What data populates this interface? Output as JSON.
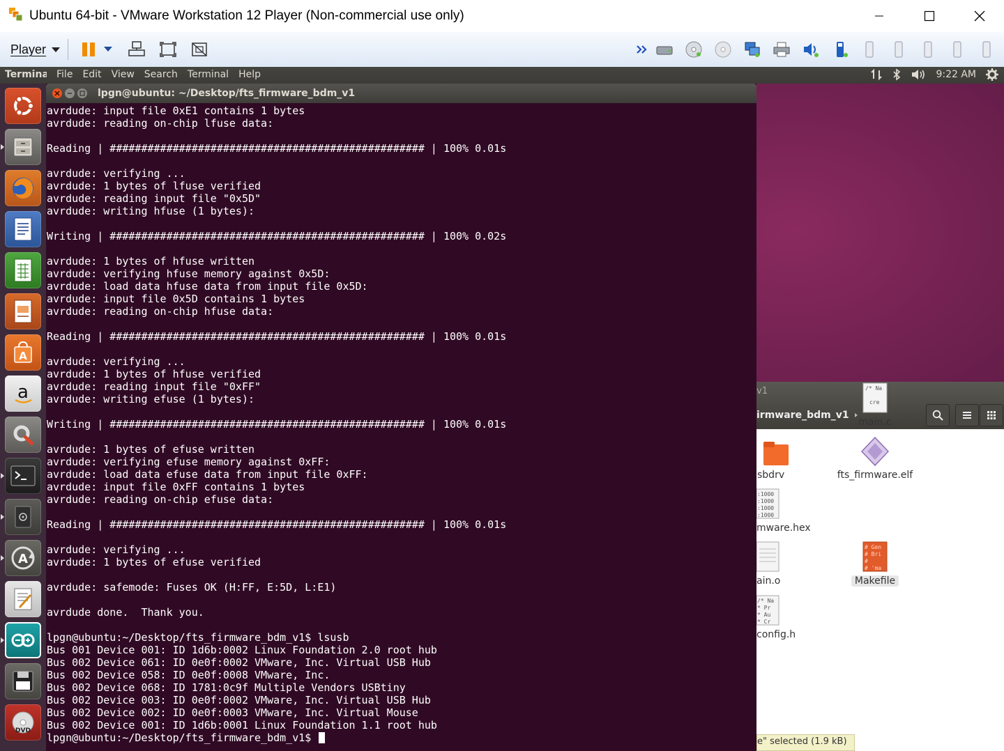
{
  "window": {
    "title": "Ubuntu 64-bit - VMware Workstation 12 Player (Non-commercial use only)"
  },
  "vm_toolbar": {
    "player_label": "Player"
  },
  "ubuntu_panel": {
    "app_name": "Terminal",
    "menus": [
      "File",
      "Edit",
      "View",
      "Search",
      "Terminal",
      "Help"
    ],
    "time": "9:22 AM"
  },
  "terminal": {
    "title": "lpgn@ubuntu: ~/Desktop/fts_firmware_bdm_v1",
    "lines": [
      "avrdude: input file 0xE1 contains 1 bytes",
      "avrdude: reading on-chip lfuse data:",
      "",
      "Reading | ################################################## | 100% 0.01s",
      "",
      "avrdude: verifying ...",
      "avrdude: 1 bytes of lfuse verified",
      "avrdude: reading input file \"0x5D\"",
      "avrdude: writing hfuse (1 bytes):",
      "",
      "Writing | ################################################## | 100% 0.02s",
      "",
      "avrdude: 1 bytes of hfuse written",
      "avrdude: verifying hfuse memory against 0x5D:",
      "avrdude: load data hfuse data from input file 0x5D:",
      "avrdude: input file 0x5D contains 1 bytes",
      "avrdude: reading on-chip hfuse data:",
      "",
      "Reading | ################################################## | 100% 0.01s",
      "",
      "avrdude: verifying ...",
      "avrdude: 1 bytes of hfuse verified",
      "avrdude: reading input file \"0xFF\"",
      "avrdude: writing efuse (1 bytes):",
      "",
      "Writing | ################################################## | 100% 0.01s",
      "",
      "avrdude: 1 bytes of efuse written",
      "avrdude: verifying efuse memory against 0xFF:",
      "avrdude: load data efuse data from input file 0xFF:",
      "avrdude: input file 0xFF contains 1 bytes",
      "avrdude: reading on-chip efuse data:",
      "",
      "Reading | ################################################## | 100% 0.01s",
      "",
      "avrdude: verifying ...",
      "avrdude: 1 bytes of efuse verified",
      "",
      "avrdude: safemode: Fuses OK (H:FF, E:5D, L:E1)",
      "",
      "avrdude done.  Thank you.",
      "",
      "lpgn@ubuntu:~/Desktop/fts_firmware_bdm_v1$ lsusb",
      "Bus 001 Device 001: ID 1d6b:0002 Linux Foundation 2.0 root hub",
      "Bus 002 Device 061: ID 0e0f:0002 VMware, Inc. Virtual USB Hub",
      "Bus 002 Device 058: ID 0e0f:0008 VMware, Inc.",
      "Bus 002 Device 068: ID 1781:0c9f Multiple Vendors USBtiny",
      "Bus 002 Device 003: ID 0e0f:0002 VMware, Inc. Virtual USB Hub",
      "Bus 002 Device 002: ID 0e0f:0003 VMware, Inc. Virtual Mouse",
      "Bus 002 Device 001: ID 1d6b:0001 Linux Foundation 1.1 root hub"
    ],
    "prompt": "lpgn@ubuntu:~/Desktop/fts_firmware_bdm_v1$ "
  },
  "file_manager": {
    "title_fragment": "v1",
    "path_label": "irmware_bdm_v1",
    "files": [
      {
        "name": "sbdrv",
        "icon": "folder-icon"
      },
      {
        "name": "fts_firmware.elf",
        "icon": "binary-icon"
      },
      {
        "name": "mware.hex",
        "icon": "hex-file-icon"
      },
      {
        "name": "main.c",
        "icon": "c-source-icon"
      },
      {
        "name": "ain.o",
        "icon": "object-file-icon"
      },
      {
        "name": "Makefile",
        "icon": "makefile-icon"
      },
      {
        "name": "config.h",
        "icon": "header-file-icon"
      }
    ],
    "status": "e\" selected  (1.9 kB)"
  },
  "colors": {
    "terminal_bg": "#300a24",
    "panel_bg": "#3c3b37",
    "launcher_bg": "#3d2a3a",
    "close_button": "#e95420"
  }
}
